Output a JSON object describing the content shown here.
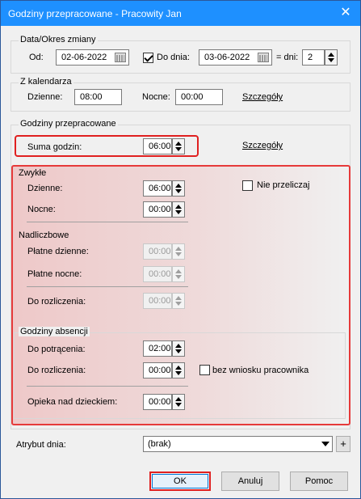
{
  "window": {
    "title": "Godziny przepracowane - Pracowity Jan",
    "close_glyph": "✕"
  },
  "data_okres": {
    "legend": "Data/Okres zmiany",
    "od_label": "Od:",
    "od_value": "02-06-2022",
    "do_dnia_checked": true,
    "do_dnia_label": "Do dnia:",
    "do_dnia_value": "03-06-2022",
    "dni_label": "= dni:",
    "dni_value": "2"
  },
  "z_kalendarza": {
    "legend": "Z kalendarza",
    "dzienne_label": "Dzienne:",
    "dzienne_value": "08:00",
    "nocne_label": "Nocne:",
    "nocne_value": "00:00",
    "szczegoly_link": "Szczegóły"
  },
  "godziny_przepracowane": {
    "legend": "Godziny przepracowane",
    "suma_label": "Suma godzin:",
    "suma_value": "06:00",
    "szczegoly_link": "Szczegóły",
    "zwykle": {
      "heading": "Zwykłe",
      "dzienne_label": "Dzienne:",
      "dzienne_value": "06:00",
      "nocne_label": "Nocne:",
      "nocne_value": "00:00",
      "nie_przeliczaj_label": "Nie przeliczaj",
      "nie_przeliczaj_checked": false
    },
    "nadliczbowe": {
      "heading": "Nadliczbowe",
      "platne_dzienne_label": "Płatne dzienne:",
      "platne_dzienne_value": "00:00",
      "platne_nocne_label": "Płatne nocne:",
      "platne_nocne_value": "00:00",
      "do_rozliczenia_label": "Do rozliczenia:",
      "do_rozliczenia_value": "00:00"
    }
  },
  "godziny_absencji": {
    "legend": "Godziny absencji",
    "do_potracenia_label": "Do potrącenia:",
    "do_potracenia_value": "02:00",
    "do_rozliczenia_label": "Do rozliczenia:",
    "do_rozliczenia_value": "00:00",
    "bez_wniosku_label": "bez wniosku pracownika",
    "bez_wniosku_checked": false,
    "opieka_label": "Opieka nad dzieckiem:",
    "opieka_value": "00:00"
  },
  "atrybut": {
    "label": "Atrybut dnia:",
    "value": "(brak)",
    "add_glyph": "+"
  },
  "buttons": {
    "ok": "OK",
    "anuluj": "Anuluj",
    "pomoc": "Pomoc"
  },
  "colors": {
    "titlebar": "#1e90ff",
    "highlight_red": "#e02020"
  }
}
